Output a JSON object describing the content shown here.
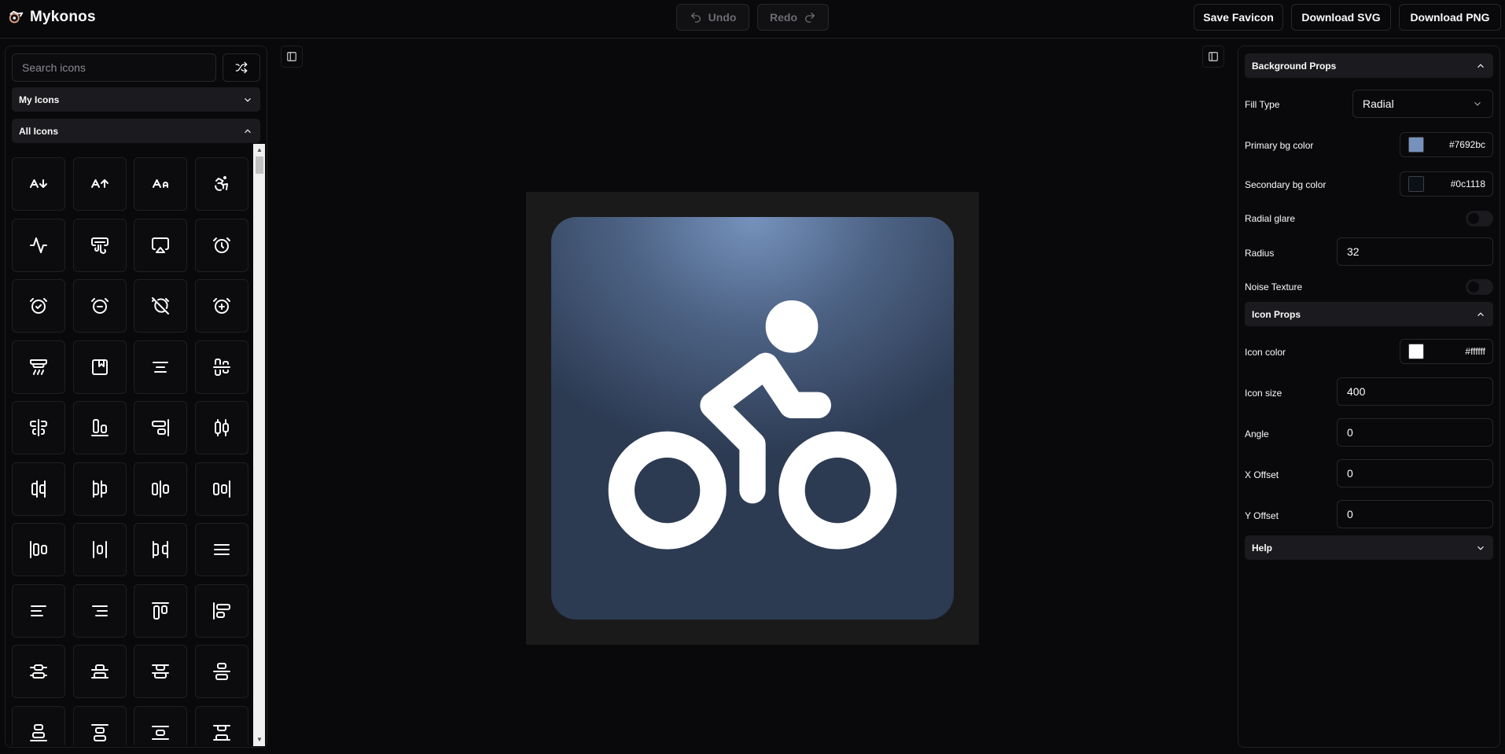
{
  "app": {
    "name": "Mykonos"
  },
  "toolbar": {
    "undo_label": "Undo",
    "redo_label": "Redo",
    "save_favicon_label": "Save Favicon",
    "download_svg_label": "Download SVG",
    "download_png_label": "Download PNG"
  },
  "left": {
    "search_placeholder": "Search icons",
    "my_icons_label": "My Icons",
    "all_icons_label": "All Icons",
    "icons": [
      "a-arrow-down-icon",
      "a-arrow-up-icon",
      "a-large-small-icon",
      "accessibility-icon",
      "activity-icon",
      "air-vent-icon",
      "airplay-icon",
      "alarm-clock-icon",
      "alarm-clock-check-icon",
      "alarm-clock-minus-icon",
      "alarm-clock-off-icon",
      "alarm-clock-plus-icon",
      "alarm-smoke-icon",
      "album-icon",
      "align-center-icon",
      "align-center-horizontal-icon",
      "align-center-vertical-icon",
      "align-end-horizontal-icon",
      "align-end-vertical-icon",
      "align-horizontal-distribute-center-icon",
      "align-horizontal-distribute-end-icon",
      "align-horizontal-distribute-start-icon",
      "align-horizontal-justify-center-icon",
      "align-horizontal-justify-end-icon",
      "align-horizontal-justify-start-icon",
      "align-horizontal-space-around-icon",
      "align-horizontal-space-between-icon",
      "align-justify-icon",
      "align-left-icon",
      "align-right-icon",
      "align-start-horizontal-icon",
      "align-start-vertical-icon",
      "align-vertical-distribute-center-icon",
      "align-vertical-distribute-end-icon",
      "align-vertical-distribute-start-icon",
      "align-vertical-justify-center-icon",
      "align-vertical-justify-end-icon",
      "align-vertical-justify-start-icon",
      "align-vertical-space-around-icon",
      "align-vertical-space-between-icon"
    ]
  },
  "canvas": {
    "icon": "bike-icon",
    "colors": {
      "primary": "#7692bc",
      "secondary": "#0c1118",
      "icon": "#ffffff"
    }
  },
  "right": {
    "background_props_label": "Background Props",
    "fill_type_label": "Fill Type",
    "fill_type_value": "Radial",
    "primary_bg_label": "Primary bg color",
    "primary_bg_value": "#7692bc",
    "secondary_bg_label": "Secondary bg color",
    "secondary_bg_value": "#0c1118",
    "radial_glare_label": "Radial glare",
    "radial_glare_on": false,
    "radius_label": "Radius",
    "radius_value": "32",
    "noise_texture_label": "Noise Texture",
    "noise_texture_on": false,
    "icon_props_label": "Icon Props",
    "icon_color_label": "Icon color",
    "icon_color_value": "#ffffff",
    "icon_size_label": "Icon size",
    "icon_size_value": "400",
    "angle_label": "Angle",
    "angle_value": "0",
    "x_offset_label": "X Offset",
    "x_offset_value": "0",
    "y_offset_label": "Y Offset",
    "y_offset_value": "0",
    "help_label": "Help"
  }
}
